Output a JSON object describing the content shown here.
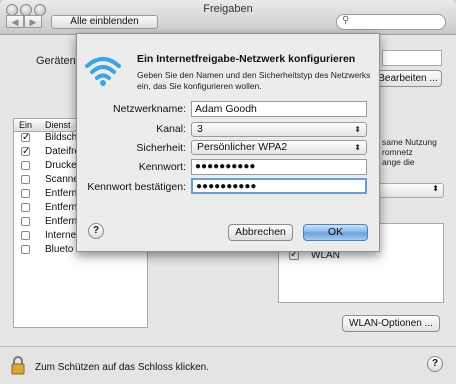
{
  "window": {
    "title": "Freigaben",
    "show_all": "Alle einblenden",
    "back_icon": "chevron-left-icon",
    "forward_icon": "chevron-right-icon",
    "search_icon": "magnifier-icon"
  },
  "background": {
    "computer_name_label": "Gerätena",
    "edit_button": "Bearbeiten ...",
    "services_header": {
      "on": "Ein",
      "service": "Dienst"
    },
    "services": [
      {
        "name": "Bildsch",
        "checked": true
      },
      {
        "name": "Dateifre",
        "checked": true
      },
      {
        "name": "Drucke",
        "checked": false
      },
      {
        "name": "Scanne",
        "checked": false
      },
      {
        "name": "Entfern",
        "checked": false
      },
      {
        "name": "Entfern",
        "checked": false
      },
      {
        "name": "Entfern",
        "checked": false
      },
      {
        "name": "Interne",
        "checked": false
      },
      {
        "name": "Blueto",
        "checked": false
      }
    ],
    "right_text": "same Nutzung\nromnetz\nange die",
    "wlan_item": "WLAN",
    "wlan_options_button": "WLAN-Optionen ...",
    "lock_text": "Zum Schützen auf das Schloss klicken."
  },
  "dialog": {
    "icon": "wifi-icon",
    "title": "Ein Internetfreigabe-Netzwerk konfigurieren",
    "description": "Geben Sie den Namen und den Sicherheitstyp des Netzwerks ein, das Sie konfigurieren wollen.",
    "fields": {
      "network_name": {
        "label": "Netzwerkname:",
        "value": "Adam Goodh"
      },
      "channel": {
        "label": "Kanal:",
        "value": "3"
      },
      "security": {
        "label": "Sicherheit:",
        "value": "Persönlicher WPA2"
      },
      "password": {
        "label": "Kennwort:",
        "value": "●●●●●●●●●●"
      },
      "confirm": {
        "label": "Kennwort bestätigen:",
        "value": "●●●●●●●●●●"
      }
    },
    "help": "?",
    "cancel": "Abbrechen",
    "ok": "OK"
  },
  "footer_help": "?"
}
